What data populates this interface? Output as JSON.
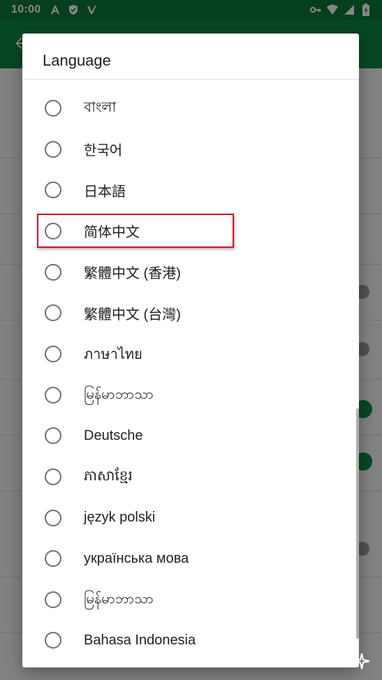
{
  "status_bar": {
    "time": "10:00",
    "left_icons": [
      "font-a-icon",
      "shield-check-icon",
      "v-logo-icon"
    ],
    "right_icons": [
      "key-icon",
      "wifi-icon",
      "signal-icon",
      "battery-icon"
    ]
  },
  "colors": {
    "primary": "#0e8a45",
    "primary_dark": "#0b7a3b",
    "highlight": "#d2141f"
  },
  "dialog": {
    "title": "Language",
    "options": [
      {
        "label": "বাংলা",
        "selected": false
      },
      {
        "label": "한국어",
        "selected": false
      },
      {
        "label": "日本語",
        "selected": false
      },
      {
        "label": "简体中文",
        "selected": false
      },
      {
        "label": "繁體中文 (香港)",
        "selected": false
      },
      {
        "label": "繁體中文 (台灣)",
        "selected": false
      },
      {
        "label": "ภาษาไทย",
        "selected": false
      },
      {
        "label": "မြန်မာဘာသာ",
        "selected": false
      },
      {
        "label": "Deutsche",
        "selected": false
      },
      {
        "label": "ភាសាខ្មែរ",
        "selected": false
      },
      {
        "label": "język polski",
        "selected": false
      },
      {
        "label": "українська мова",
        "selected": false
      },
      {
        "label": "မြန်မာဘာသာ",
        "selected": false
      },
      {
        "label": "Bahasa Indonesia",
        "selected": false
      }
    ]
  }
}
